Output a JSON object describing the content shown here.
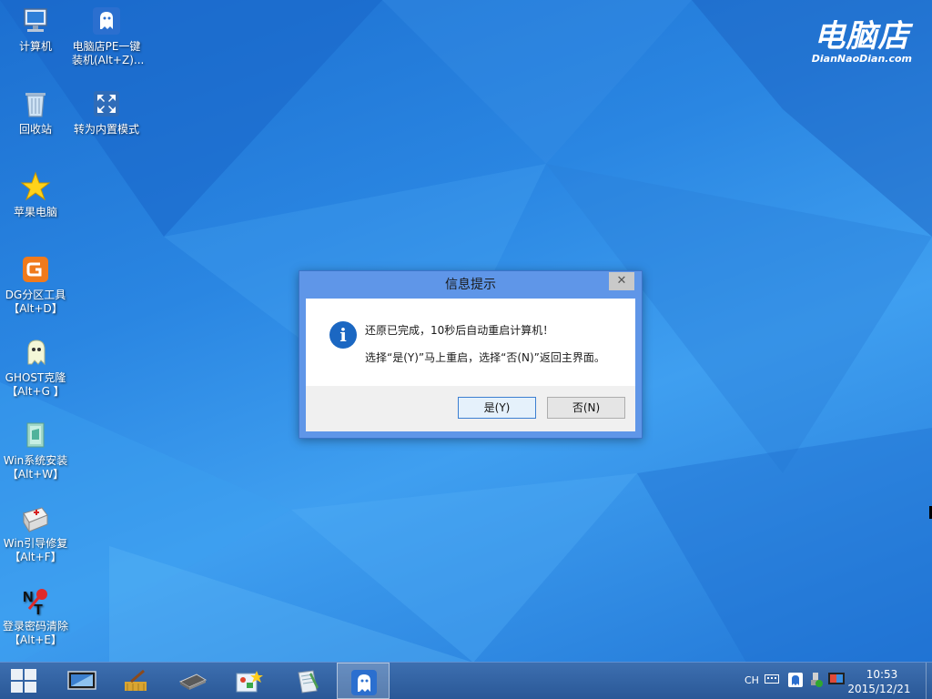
{
  "desktop_icons": [
    {
      "name": "computer",
      "label1": "计算机",
      "label2": ""
    },
    {
      "name": "one-key",
      "label1": "电脑店PE一键",
      "label2": "装机(Alt+Z)..."
    },
    {
      "name": "recycle",
      "label1": "回收站",
      "label2": ""
    },
    {
      "name": "builtin-mode",
      "label1": "转为内置模式",
      "label2": ""
    },
    {
      "name": "apple",
      "label1": "苹果电脑",
      "label2": ""
    },
    {
      "name": "dg",
      "label1": "DG分区工具",
      "label2": "【Alt+D】"
    },
    {
      "name": "ghost",
      "label1": "GHOST克隆",
      "label2": "【Alt+G 】"
    },
    {
      "name": "win-install",
      "label1": "Win系统安装",
      "label2": "【Alt+W】"
    },
    {
      "name": "win-boot",
      "label1": "Win引导修复",
      "label2": "【Alt+F】"
    },
    {
      "name": "password",
      "label1": "登录密码清除",
      "label2": "【Alt+E】"
    }
  ],
  "logo": {
    "big": "电脑店",
    "small": "DianNaoDian.com"
  },
  "dialog": {
    "title": "信息提示",
    "close": "✕",
    "icon": "i",
    "line1": "还原已完成，10秒后自动重启计算机！",
    "line2": "选择“是(Y)”马上重启，选择“否(N)”返回主界面。",
    "yes": "是(Y)",
    "no": "否(N)"
  },
  "taskbar": {
    "items": [
      "start-icon",
      "screen-icon",
      "broom-icon",
      "ram-icon",
      "tools-icon",
      "notepad-icon",
      "ghost-icon"
    ],
    "active_index": 6
  },
  "tray": {
    "lang": "CH",
    "time": "10:53",
    "date": "2015/12/21"
  }
}
